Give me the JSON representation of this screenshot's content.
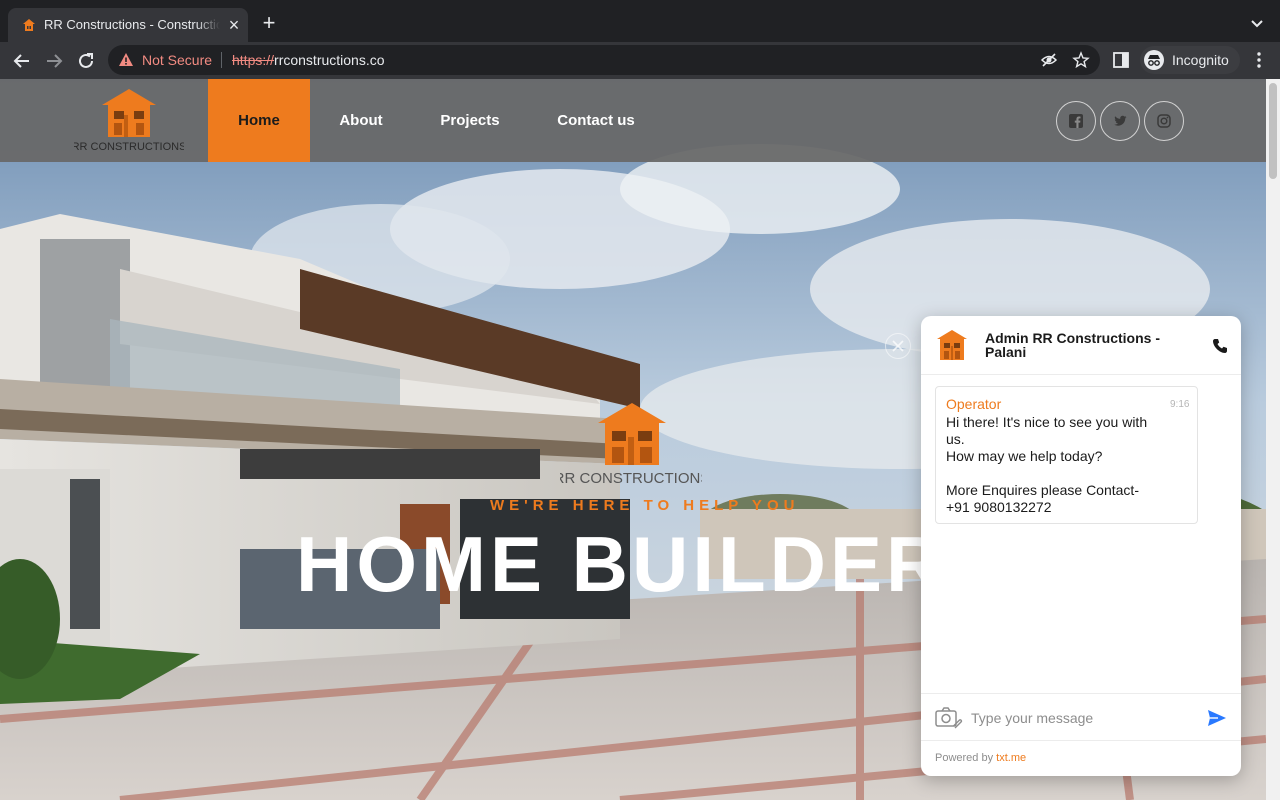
{
  "browser": {
    "tab_title": "RR Constructions - Constructio",
    "new_tab_symbol": "+",
    "close_symbol": "×",
    "not_secure_label": "Not Secure",
    "url_scheme": "https://",
    "url_host": "rrconstructions.co",
    "incognito_label": "Incognito"
  },
  "site": {
    "logo_text": "RR CONSTRUCTIONS",
    "nav": [
      {
        "label": "Home",
        "active": true
      },
      {
        "label": "About",
        "active": false
      },
      {
        "label": "Projects",
        "active": false
      },
      {
        "label": "Contact us",
        "active": false
      }
    ],
    "social_icons": [
      "facebook-icon",
      "twitter-icon",
      "instagram-icon"
    ],
    "hero_logo_text": "RR CONSTRUCTIONS",
    "hero_tagline": "WE'RE HERE TO HELP YOU",
    "hero_title": "HOME BUILDER"
  },
  "chat": {
    "agent_name": "Admin RR Constructions - Palani",
    "message": {
      "author": "Operator",
      "time": "9:16",
      "text": "Hi there! It's nice to see you with us.\nHow may we help today?\n\nMore Enquires please Contact-\n+91 9080132272"
    },
    "input_placeholder": "Type your message",
    "powered_prefix": "Powered by",
    "powered_brand": "txt.me"
  },
  "colors": {
    "brand_orange": "#ee7b1e",
    "header_gray": "#686868",
    "not_secure_red": "#f28b82",
    "send_blue": "#2979ff"
  }
}
